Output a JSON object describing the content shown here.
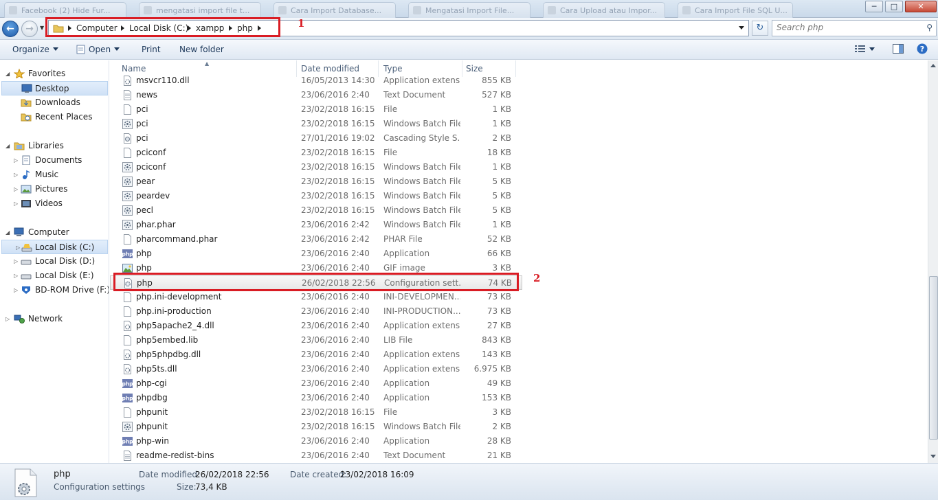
{
  "browser_tabs": [
    {
      "label": "Facebook (2) Hide Fur..."
    },
    {
      "label": "mengatasi import file t..."
    },
    {
      "label": "Cara Import Database..."
    },
    {
      "label": "Mengatasi Import File..."
    },
    {
      "label": "Cara Upload atau Impor..."
    },
    {
      "label": "Cara Import File SQL U..."
    }
  ],
  "window_controls": {
    "minimize": "─",
    "maximize": "□",
    "close": "✕"
  },
  "address": {
    "crumbs": [
      "Computer",
      "Local Disk (C:)",
      "xampp",
      "php"
    ]
  },
  "search": {
    "placeholder": "Search php"
  },
  "annotations": {
    "one": "1",
    "two": "2"
  },
  "toolbar": {
    "organize": "Organize",
    "open": "Open",
    "print": "Print",
    "new_folder": "New folder"
  },
  "nav": {
    "favorites": "Favorites",
    "desktop": "Desktop",
    "downloads": "Downloads",
    "recent_places": "Recent Places",
    "libraries": "Libraries",
    "documents": "Documents",
    "music": "Music",
    "pictures": "Pictures",
    "videos": "Videos",
    "computer": "Computer",
    "local_c": "Local Disk (C:)",
    "local_d": "Local Disk (D:)",
    "local_e": "Local Disk (E:)",
    "bdrom": "BD-ROM Drive (F:) R",
    "network": "Network"
  },
  "columns": {
    "name": "Name",
    "date": "Date modified",
    "type": "Type",
    "size": "Size"
  },
  "files": [
    {
      "name": "msvcr110.dll",
      "date": "16/05/2013 14:30",
      "type": "Application extens...",
      "size": "855 KB",
      "icon": "dll"
    },
    {
      "name": "news",
      "date": "23/06/2016 2:40",
      "type": "Text Document",
      "size": "527 KB",
      "icon": "txt"
    },
    {
      "name": "pci",
      "date": "23/02/2018 16:15",
      "type": "File",
      "size": "1 KB",
      "icon": "file"
    },
    {
      "name": "pci",
      "date": "23/02/2018 16:15",
      "type": "Windows Batch File",
      "size": "1 KB",
      "icon": "bat"
    },
    {
      "name": "pci",
      "date": "27/01/2016 19:02",
      "type": "Cascading Style S...",
      "size": "2 KB",
      "icon": "css"
    },
    {
      "name": "pciconf",
      "date": "23/02/2018 16:15",
      "type": "File",
      "size": "18 KB",
      "icon": "file"
    },
    {
      "name": "pciconf",
      "date": "23/02/2018 16:15",
      "type": "Windows Batch File",
      "size": "1 KB",
      "icon": "bat"
    },
    {
      "name": "pear",
      "date": "23/02/2018 16:15",
      "type": "Windows Batch File",
      "size": "5 KB",
      "icon": "bat"
    },
    {
      "name": "peardev",
      "date": "23/02/2018 16:15",
      "type": "Windows Batch File",
      "size": "5 KB",
      "icon": "bat"
    },
    {
      "name": "pecl",
      "date": "23/02/2018 16:15",
      "type": "Windows Batch File",
      "size": "5 KB",
      "icon": "bat"
    },
    {
      "name": "phar.phar",
      "date": "23/06/2016 2:42",
      "type": "Windows Batch File",
      "size": "1 KB",
      "icon": "bat"
    },
    {
      "name": "pharcommand.phar",
      "date": "23/06/2016 2:42",
      "type": "PHAR File",
      "size": "52 KB",
      "icon": "file"
    },
    {
      "name": "php",
      "date": "23/06/2016 2:40",
      "type": "Application",
      "size": "66 KB",
      "icon": "php"
    },
    {
      "name": "php",
      "date": "23/06/2016 2:40",
      "type": "GIF image",
      "size": "3 KB",
      "icon": "gif"
    },
    {
      "name": "php",
      "date": "26/02/2018 22:56",
      "type": "Configuration sett...",
      "size": "74 KB",
      "icon": "ini",
      "highlighted": true
    },
    {
      "name": "php.ini-development",
      "date": "23/06/2016 2:40",
      "type": "INI-DEVELOPMEN...",
      "size": "73 KB",
      "icon": "file"
    },
    {
      "name": "php.ini-production",
      "date": "23/06/2016 2:40",
      "type": "INI-PRODUCTION...",
      "size": "73 KB",
      "icon": "file"
    },
    {
      "name": "php5apache2_4.dll",
      "date": "23/06/2016 2:40",
      "type": "Application extens...",
      "size": "27 KB",
      "icon": "dll"
    },
    {
      "name": "php5embed.lib",
      "date": "23/06/2016 2:40",
      "type": "LIB File",
      "size": "843 KB",
      "icon": "file"
    },
    {
      "name": "php5phpdbg.dll",
      "date": "23/06/2016 2:40",
      "type": "Application extens...",
      "size": "143 KB",
      "icon": "dll"
    },
    {
      "name": "php5ts.dll",
      "date": "23/06/2016 2:40",
      "type": "Application extens...",
      "size": "6.975 KB",
      "icon": "dll"
    },
    {
      "name": "php-cgi",
      "date": "23/06/2016 2:40",
      "type": "Application",
      "size": "49 KB",
      "icon": "php"
    },
    {
      "name": "phpdbg",
      "date": "23/06/2016 2:40",
      "type": "Application",
      "size": "153 KB",
      "icon": "php"
    },
    {
      "name": "phpunit",
      "date": "23/02/2018 16:15",
      "type": "File",
      "size": "3 KB",
      "icon": "file"
    },
    {
      "name": "phpunit",
      "date": "23/02/2018 16:15",
      "type": "Windows Batch File",
      "size": "2 KB",
      "icon": "bat"
    },
    {
      "name": "php-win",
      "date": "23/06/2016 2:40",
      "type": "Application",
      "size": "28 KB",
      "icon": "php"
    },
    {
      "name": "readme-redist-bins",
      "date": "23/06/2016 2:40",
      "type": "Text Document",
      "size": "21 KB",
      "icon": "txt"
    }
  ],
  "details": {
    "name": "php",
    "type": "Configuration settings",
    "modified_label": "Date modified:",
    "modified": "26/02/2018 22:56",
    "created_label": "Date created:",
    "created": "23/02/2018 16:09",
    "size_label": "Size:",
    "size": "73,4 KB"
  },
  "colors": {
    "annotation_red": "#d91c24",
    "selection_blue": "#cfe1f6"
  }
}
